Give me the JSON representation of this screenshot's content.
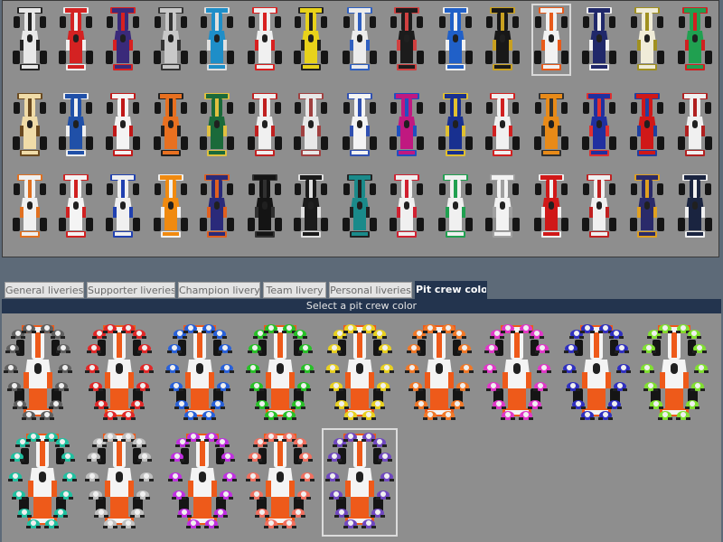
{
  "livery_grid": {
    "rows": 3,
    "cols": 15,
    "selected_index": 11,
    "cars": [
      {
        "body": "#e8e8e8",
        "accent": "#222222"
      },
      {
        "body": "#d42222",
        "accent": "#f0f0f0"
      },
      {
        "body": "#3a2a7a",
        "accent": "#d82020"
      },
      {
        "body": "#c8c8c8",
        "accent": "#333333"
      },
      {
        "body": "#1e8ec8",
        "accent": "#e0e0e0"
      },
      {
        "body": "#f0f0f0",
        "accent": "#d82020"
      },
      {
        "body": "#e8d21a",
        "accent": "#202020"
      },
      {
        "body": "#ececec",
        "accent": "#3060c0"
      },
      {
        "body": "#1c1c1c",
        "accent": "#d04040"
      },
      {
        "body": "#2060c8",
        "accent": "#f0f0f0"
      },
      {
        "body": "#181818",
        "accent": "#c8a020"
      },
      {
        "body": "#f2f2f2",
        "accent": "#e85a1a"
      },
      {
        "body": "#20286a",
        "accent": "#f0f0f0"
      },
      {
        "body": "#f0ecd8",
        "accent": "#a09020"
      },
      {
        "body": "#20a050",
        "accent": "#d02020"
      },
      {
        "body": "#f0dca8",
        "accent": "#6a4a20"
      },
      {
        "body": "#2050a8",
        "accent": "#f0f0f0"
      },
      {
        "body": "#f4f4f4",
        "accent": "#c01818"
      },
      {
        "body": "#e87020",
        "accent": "#202020"
      },
      {
        "body": "#1a6a3a",
        "accent": "#e0c040"
      },
      {
        "body": "#f0f0f0",
        "accent": "#c02020"
      },
      {
        "body": "#e8e8e8",
        "accent": "#a04040"
      },
      {
        "body": "#f4f4f4",
        "accent": "#3050b0"
      },
      {
        "body": "#c01880",
        "accent": "#2050c0"
      },
      {
        "body": "#183090",
        "accent": "#e0c030"
      },
      {
        "body": "#f0f0f0",
        "accent": "#d02020"
      },
      {
        "body": "#e88a18",
        "accent": "#303030"
      },
      {
        "body": "#2030a0",
        "accent": "#e03030"
      },
      {
        "body": "#d01818",
        "accent": "#2040a0"
      },
      {
        "body": "#f0f0f0",
        "accent": "#b02020"
      },
      {
        "body": "#f0f0f0",
        "accent": "#e07020"
      },
      {
        "body": "#f4f4f4",
        "accent": "#d02020"
      },
      {
        "body": "#f0f0f0",
        "accent": "#2040b0"
      },
      {
        "body": "#f08a10",
        "accent": "#f0f0f0"
      },
      {
        "body": "#2a2a7a",
        "accent": "#e06020"
      },
      {
        "body": "#141414",
        "accent": "#303030"
      },
      {
        "body": "#1a1a1a",
        "accent": "#e0e0e0"
      },
      {
        "body": "#1a8a8a",
        "accent": "#202020"
      },
      {
        "body": "#f0f0f0",
        "accent": "#d02030"
      },
      {
        "body": "#f0f0f0",
        "accent": "#20a050"
      },
      {
        "body": "#f2f2f2",
        "accent": "#a0a0a0"
      },
      {
        "body": "#d01818",
        "accent": "#f0f0f0"
      },
      {
        "body": "#f0f0f0",
        "accent": "#c02020"
      },
      {
        "body": "#2a2a6a",
        "accent": "#e0a020"
      },
      {
        "body": "#1a2440",
        "accent": "#f0f0f0"
      }
    ]
  },
  "tabs": [
    {
      "label": "General liveries",
      "active": false
    },
    {
      "label": "Supporter liveries",
      "active": false
    },
    {
      "label": "Champion livery",
      "active": false
    },
    {
      "label": "Team livery",
      "active": false
    },
    {
      "label": "Personal liveries",
      "active": false
    },
    {
      "label": "Pit crew color",
      "active": true
    }
  ],
  "pit_crew": {
    "header": "Select a pit crew color",
    "selected_index": 13,
    "colors": [
      "#606060",
      "#e02828",
      "#2860d8",
      "#28c028",
      "#e8d020",
      "#f07828",
      "#e038c8",
      "#3030c0",
      "#80e030",
      "#20c0a0",
      "#c0c0c0",
      "#c030e0",
      "#f07060",
      "#7048c0"
    ]
  },
  "theme": {
    "panel_bg": "#8e8e8e",
    "page_bg": "#5d6a78",
    "header_bg": "#23344e",
    "crew_car_color": "#ee5a1a"
  }
}
